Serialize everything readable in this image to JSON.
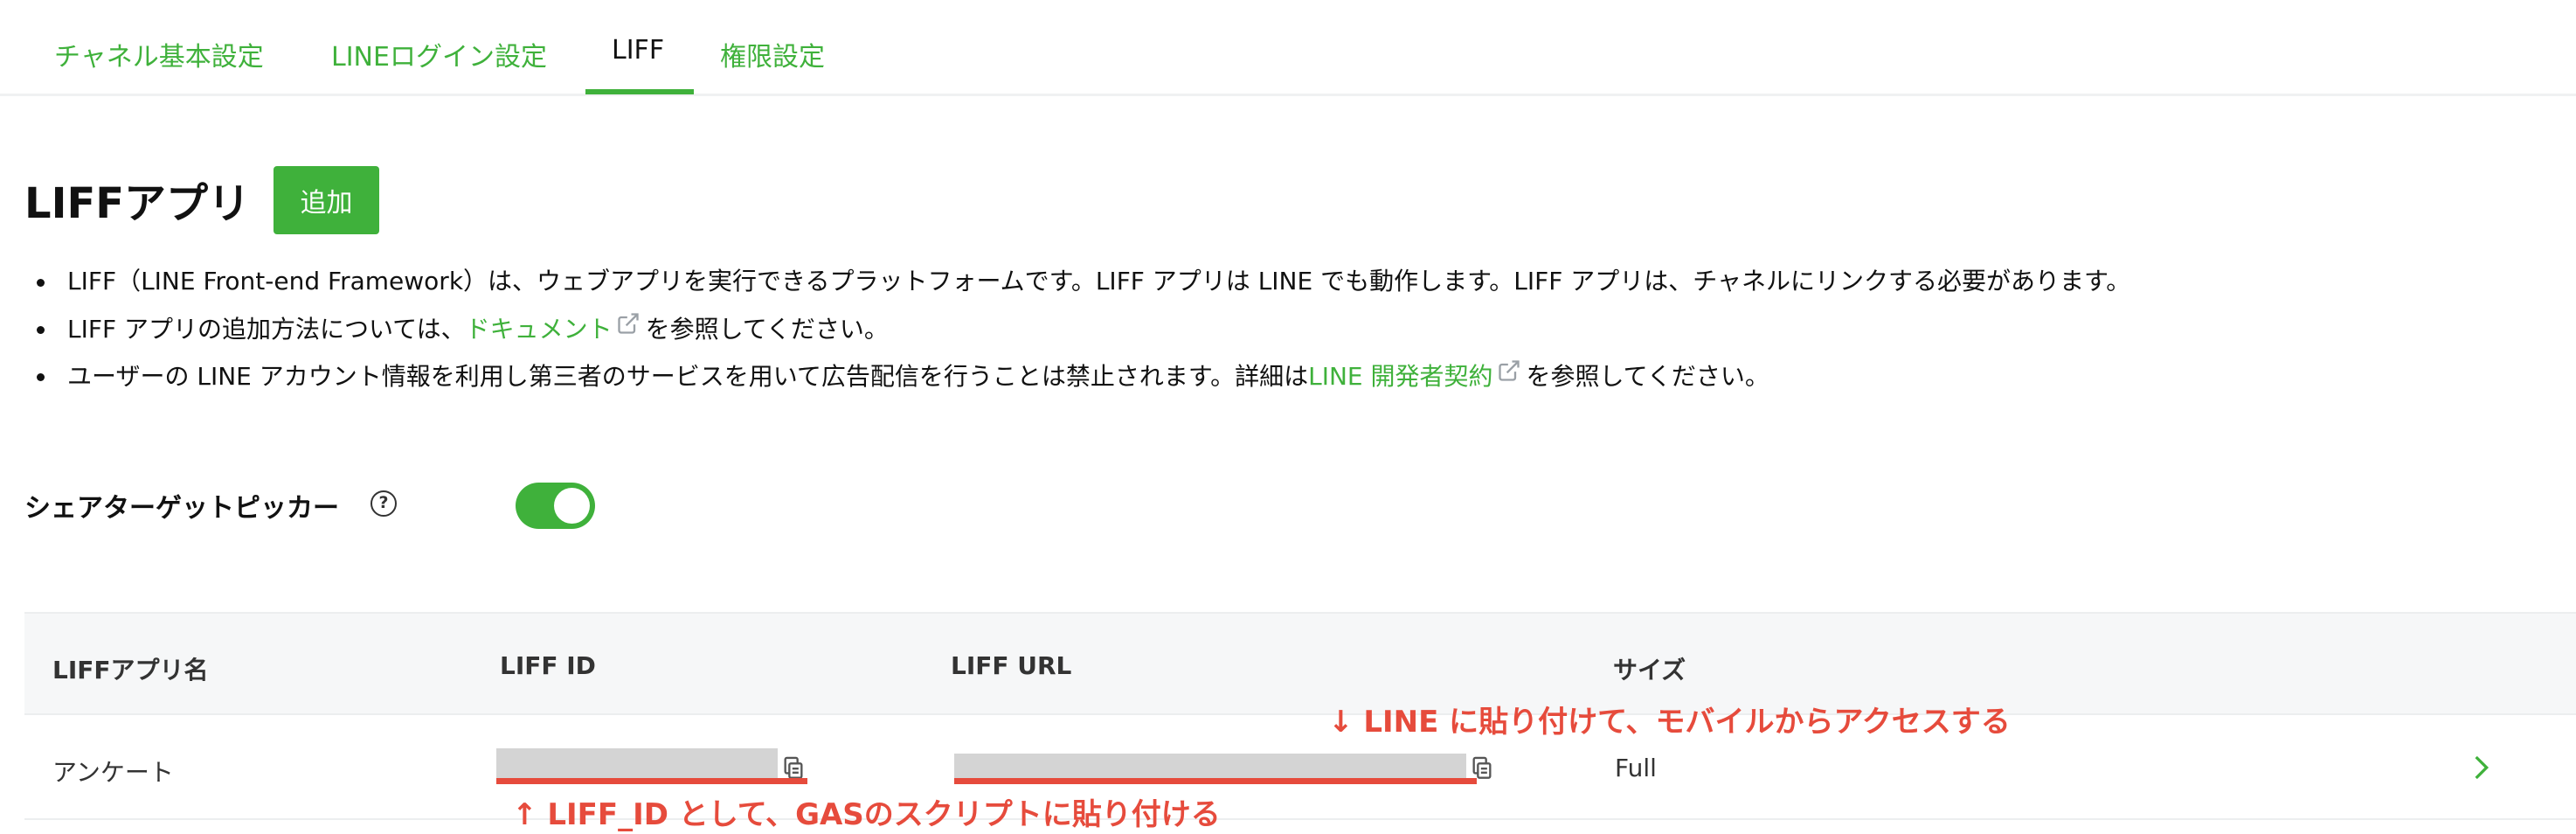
{
  "tabs": [
    {
      "label": "チャネル基本設定",
      "active": false
    },
    {
      "label": "LINEログイン設定",
      "active": false
    },
    {
      "label": "LIFF",
      "active": true
    },
    {
      "label": "権限設定",
      "active": false
    }
  ],
  "page_title": "LIFFアプリ",
  "add_button": "追加",
  "notes": {
    "n1": "LIFF（LINE Front-end Framework）は、ウェブアプリを実行できるプラットフォームです。LIFF アプリは LINE でも動作します。LIFF アプリは、チャネルにリンクする必要があります。",
    "n2_prefix": "LIFF アプリの追加方法については、",
    "n2_link": "ドキュメント",
    "n2_suffix": "を参照してください。",
    "n3_prefix": "ユーザーの LINE アカウント情報を利用し第三者のサービスを用いて広告配信を行うことは禁止されます。詳細は",
    "n3_link": "LINE 開発者契約",
    "n3_suffix": "を参照してください。"
  },
  "share_target_picker": {
    "label": "シェアターゲットピッカー",
    "help": "?",
    "enabled": true
  },
  "table": {
    "headers": {
      "name": "LIFFアプリ名",
      "id": "LIFF ID",
      "url": "LIFF URL",
      "size": "サイズ"
    },
    "rows": [
      {
        "name": "アンケート",
        "size": "Full"
      }
    ]
  },
  "annotations": {
    "url_note": "↓ LINE に貼り付けて、モバイルからアクセスする",
    "id_note": "↑ LIFF_ID として、GASのスクリプトに貼り付ける"
  },
  "colors": {
    "accent": "#3fb13b",
    "annotation": "#e64b3c",
    "masked": "#d4d4d4"
  }
}
